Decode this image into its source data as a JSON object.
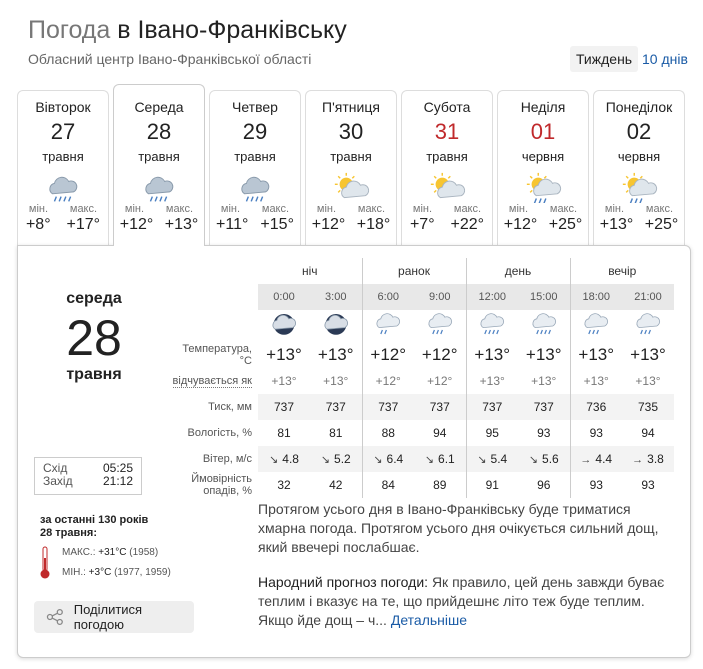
{
  "header": {
    "title_prefix": "Погода",
    "title_city": "в Івано-Франківську",
    "subtitle": "Обласний центр Івано-Франківської області",
    "period_week": "Тиждень",
    "period_ten": "10 днів"
  },
  "labels": {
    "min": "мін.",
    "max": "макс."
  },
  "days": [
    {
      "name": "Вівторок",
      "num": "27",
      "month": "травня",
      "min": "+8°",
      "max": "+17°",
      "icon": "rain-cloud-icon",
      "weekend": false
    },
    {
      "name": "Середа",
      "num": "28",
      "month": "травня",
      "min": "+12°",
      "max": "+13°",
      "icon": "rain-cloud-icon",
      "weekend": false
    },
    {
      "name": "Четвер",
      "num": "29",
      "month": "травня",
      "min": "+11°",
      "max": "+15°",
      "icon": "rain-cloud-icon",
      "weekend": false
    },
    {
      "name": "П'ятниця",
      "num": "30",
      "month": "травня",
      "min": "+12°",
      "max": "+18°",
      "icon": "sun-cloud-icon",
      "weekend": false
    },
    {
      "name": "Субота",
      "num": "31",
      "month": "травня",
      "min": "+7°",
      "max": "+22°",
      "icon": "sun-cloud-icon",
      "weekend": true
    },
    {
      "name": "Неділя",
      "num": "01",
      "month": "червня",
      "min": "+12°",
      "max": "+25°",
      "icon": "sun-cloud-rain-icon",
      "weekend": true
    },
    {
      "name": "Понеділок",
      "num": "02",
      "month": "червня",
      "min": "+13°",
      "max": "+25°",
      "icon": "sun-cloud-rain-icon",
      "weekend": false
    }
  ],
  "detail": {
    "weekday": "середа",
    "num": "28",
    "month": "травня",
    "parts": [
      "ніч",
      "ранок",
      "день",
      "вечір"
    ],
    "hours": [
      "0:00",
      "3:00",
      "6:00",
      "9:00",
      "12:00",
      "15:00",
      "18:00",
      "21:00"
    ],
    "icons": [
      "night-cloud-icon",
      "night-cloud-icon",
      "light-rain-icon",
      "rain-icon",
      "heavy-rain-icon",
      "heavy-rain-icon",
      "rain-icon",
      "rain-icon"
    ],
    "row_labels": {
      "temp": "Температура, °C",
      "feels": "відчувається як",
      "pressure": "Тиск, мм",
      "humidity": "Вологість, %",
      "wind": "Вітер, м/с",
      "precip": "Ймовірність опадів, %"
    },
    "temp": [
      "+13°",
      "+13°",
      "+12°",
      "+12°",
      "+13°",
      "+13°",
      "+13°",
      "+13°"
    ],
    "feels": [
      "+13°",
      "+13°",
      "+12°",
      "+12°",
      "+13°",
      "+13°",
      "+13°",
      "+13°"
    ],
    "pressure": [
      "737",
      "737",
      "737",
      "737",
      "737",
      "737",
      "736",
      "735"
    ],
    "humidity": [
      "81",
      "81",
      "88",
      "94",
      "95",
      "93",
      "93",
      "94"
    ],
    "wind_dir": [
      "↘",
      "↘",
      "↘",
      "↘",
      "↘",
      "↘",
      "→",
      "→"
    ],
    "wind": [
      "4.8",
      "5.2",
      "6.4",
      "6.1",
      "5.4",
      "5.6",
      "4.4",
      "3.8"
    ],
    "precip": [
      "32",
      "42",
      "84",
      "89",
      "91",
      "96",
      "93",
      "93"
    ],
    "sunrise_label": "Схід",
    "sunrise": "05:25",
    "sunset_label": "Захід",
    "sunset": "21:12",
    "history_line1": "за останні 130 років",
    "history_line2": "28 травня:",
    "hist_max_label": "МАКС.:",
    "hist_max": "+31°C",
    "hist_max_years": "(1958)",
    "hist_min_label": "МІН.:",
    "hist_min": "+3°C",
    "hist_min_years": "(1977, 1959)",
    "share_label": "Поділитися погодою",
    "description": "Протягом усього дня в Івано-Франківську буде триматися хмарна погода. Протягом усього дня очікується сильний дощ, який ввечері послабшає.",
    "folk_label": "Народний прогноз погоди:",
    "folk_text": "Як правило, цей день завжди буває теплим і вказує на те, що прийдешнє літо теж буде теплим. Якщо йде дощ – ч...",
    "folk_link": "Детальніше"
  },
  "colors": {
    "weekend": "#c0292b",
    "link": "#1a5ba6"
  }
}
